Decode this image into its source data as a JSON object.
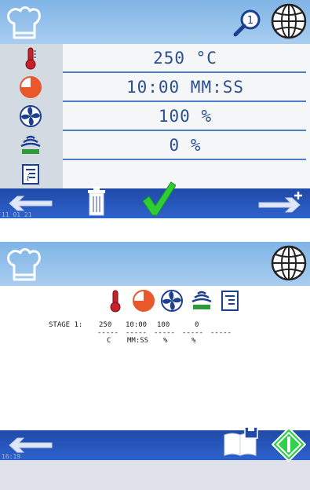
{
  "screen1": {
    "rows": [
      {
        "icon": "thermometer-icon",
        "value": "250 °C"
      },
      {
        "icon": "timer-icon",
        "value": "10:00 MM:SS"
      },
      {
        "icon": "fan-icon",
        "value": "100 %"
      },
      {
        "icon": "steam-icon",
        "value": "0 %"
      },
      {
        "icon": "info-notes-icon",
        "value": ""
      }
    ],
    "magnifier_badge": "1",
    "clock": "11 01 21"
  },
  "screen2": {
    "stage_label": "STAGE 1:",
    "values": [
      "250",
      "10:00",
      "100",
      "0"
    ],
    "dashes": [
      "-----",
      "-----",
      "-----",
      "-----",
      "-----"
    ],
    "units": [
      "C",
      "MM:SS",
      "%",
      "%"
    ],
    "clock": "16:19"
  },
  "colors": {
    "accent_blue": "#2f62cc",
    "header_blue": "#8fbdea",
    "check_green": "#2fcc35",
    "start_green": "#2fd14a",
    "thermo_red": "#c8202a",
    "timer_orange": "#e9582b",
    "value_blue": "#2b4f8f"
  }
}
